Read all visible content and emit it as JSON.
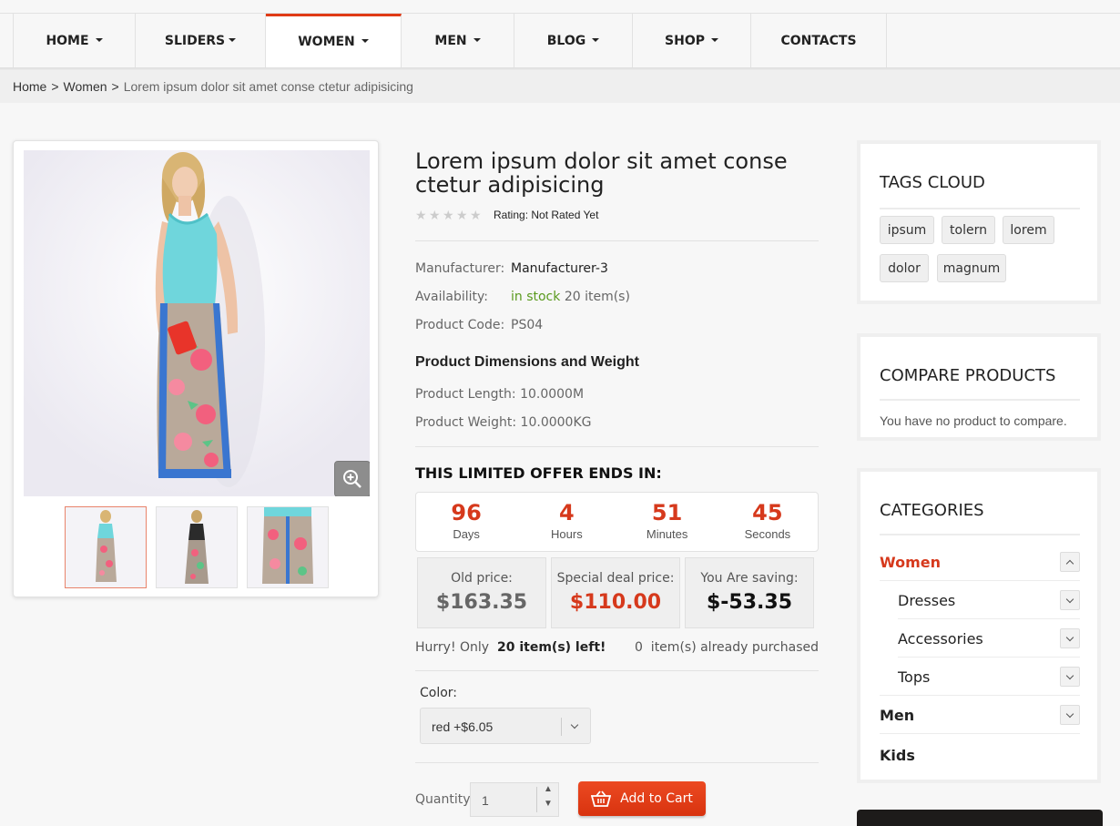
{
  "nav": {
    "items": [
      {
        "label": "HOME",
        "has_caret": true
      },
      {
        "label": "SLIDERS",
        "has_caret": true
      },
      {
        "label": "WOMEN",
        "has_caret": true,
        "active": true
      },
      {
        "label": "MEN",
        "has_caret": true
      },
      {
        "label": "BLOG",
        "has_caret": true
      },
      {
        "label": "SHOP",
        "has_caret": true
      },
      {
        "label": "CONTACTS",
        "has_caret": false
      }
    ]
  },
  "breadcrumb": {
    "items": [
      "Home",
      "Women"
    ],
    "separator": ">",
    "current": "Lorem ipsum dolor sit amet conse ctetur adipisicing"
  },
  "product": {
    "title": "Lorem ipsum dolor sit amet conse ctetur adipisicing",
    "rating_text": "Rating: Not Rated Yet",
    "stars_filled": 0,
    "manufacturer_label": "Manufacturer:",
    "manufacturer": "Manufacturer-3",
    "availability_label": "Availability:",
    "availability_status": "in stock",
    "availability_count": "20 item(s)",
    "code_label": "Product Code:",
    "code": "PS04",
    "dims_heading": "Product Dimensions and Weight",
    "length": "Product Length: 10.0000M",
    "weight": "Product Weight: 10.0000KG"
  },
  "offer": {
    "heading": "THIS LIMITED OFFER ENDS IN:",
    "countdown": [
      {
        "value": "96",
        "label": "Days"
      },
      {
        "value": "4",
        "label": "Hours"
      },
      {
        "value": "51",
        "label": "Minutes"
      },
      {
        "value": "45",
        "label": "Seconds"
      }
    ],
    "old_price_label": "Old price:",
    "old_price": "$163.35",
    "deal_price_label": "Special deal price:",
    "deal_price": "$110.00",
    "saving_label": "You Are saving:",
    "saving": "$-53.35",
    "hurry_prefix": "Hurry! Only",
    "hurry_count": "20 item(s) left!",
    "purchased": "0  item(s) already purchased"
  },
  "options": {
    "color_label": "Color:",
    "color_value": "red +$6.05",
    "quantity_label": "Quantity:",
    "quantity_value": "1",
    "add_to_cart": "Add to Cart"
  },
  "sidebar": {
    "tags_title": "TAGS CLOUD",
    "tags": [
      "ipsum",
      "tolern",
      "lorem",
      "dolor",
      "magnum"
    ],
    "compare_title": "COMPARE PRODUCTS",
    "compare_text": "You have no product to compare.",
    "categories_title": "CATEGORIES",
    "categories": [
      {
        "label": "Women",
        "toggle": "up"
      },
      {
        "label": "Dresses",
        "toggle": "down"
      },
      {
        "label": "Accessories",
        "toggle": "down"
      },
      {
        "label": "Tops",
        "toggle": "down"
      },
      {
        "label": "Men",
        "toggle": "down"
      },
      {
        "label": "Kids",
        "toggle": "none"
      }
    ]
  },
  "colors": {
    "accent": "#e03a16",
    "price_red": "#d6391c",
    "in_stock_green": "#5a9a1e"
  }
}
